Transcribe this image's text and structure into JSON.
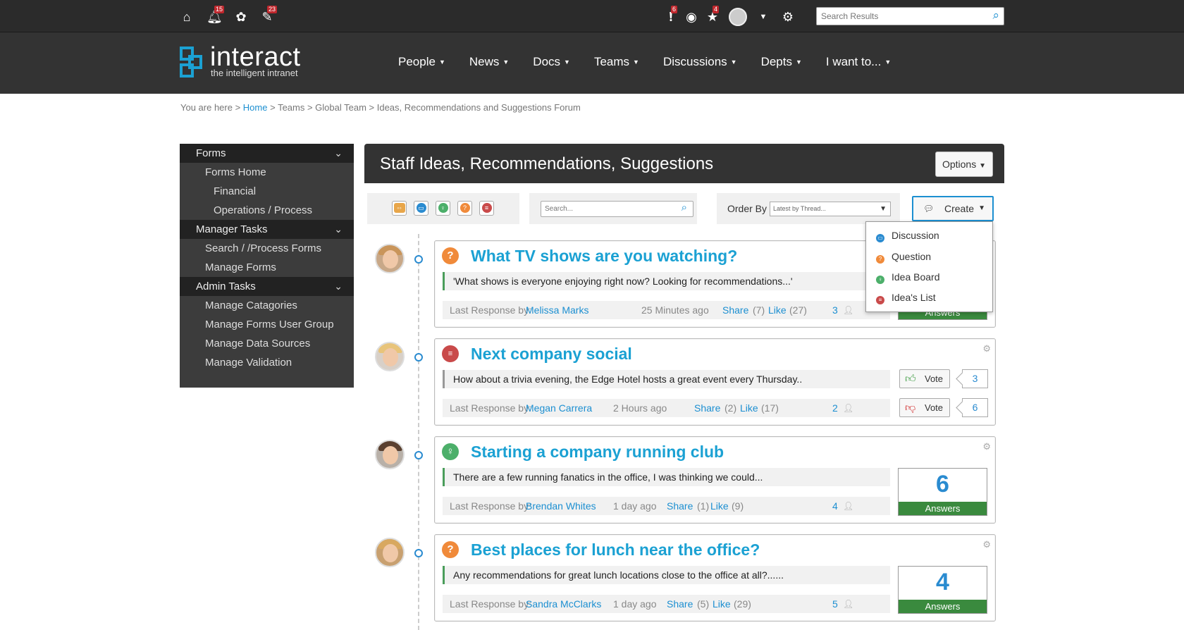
{
  "topbar": {
    "home_icon": "home-icon",
    "notifications_badge": "15",
    "flower_icon": "flower-icon",
    "docs_badge": "23",
    "alert_badge": "6",
    "star_badge": "4",
    "search_placeholder": "Search Results"
  },
  "logo": {
    "word": "interact",
    "tagline": "the intelligent intranet"
  },
  "nav": [
    {
      "label": "People"
    },
    {
      "label": "News"
    },
    {
      "label": "Docs"
    },
    {
      "label": "Teams"
    },
    {
      "label": "Discussions"
    },
    {
      "label": "Depts"
    },
    {
      "label": "I want to..."
    }
  ],
  "breadcrumb": {
    "prefix": "You are here > ",
    "home": "Home",
    "rest": " > Teams > Global Team > Ideas, Recommendations and Suggestions Forum"
  },
  "sidebar": {
    "forms": "Forms",
    "forms_home": "Forms Home",
    "financial": "Financial",
    "operations": "Operations / Process",
    "manager_tasks": "Manager Tasks",
    "search_forms": "Search / /Process Forms",
    "manage_forms": "Manage Forms",
    "admin_tasks": "Admin Tasks",
    "manage_categories": "Manage Catagories",
    "manage_user_group": "Manage Forms User Group",
    "manage_data_sources": "Manage Data Sources",
    "manage_validation": "Manage Validation"
  },
  "panel": {
    "title": "Staff Ideas, Recommendations, Suggestions",
    "options": "Options"
  },
  "toolbar": {
    "search_placeholder": "Search...",
    "order_label": "Order By",
    "order_value": "Latest by Thread...",
    "create_label": "Create"
  },
  "create_menu": [
    {
      "label": "Discussion",
      "color": "#2a8bd0"
    },
    {
      "label": "Question",
      "color": "#f08a3a"
    },
    {
      "label": "Idea Board",
      "color": "#4caf6a"
    },
    {
      "label": "Idea's List",
      "color": "#c94a4a"
    }
  ],
  "colors": {
    "accent": "#1ba1d3",
    "answers_green": "#3a8a3e",
    "question_orange": "#f08a3a",
    "idea_green": "#4caf6a",
    "idealist_red": "#c94a4a"
  },
  "posts": [
    {
      "title": "What TV shows are you watching?",
      "excerpt": "'What shows is everyone enjoying right now? Looking for recommendations...'",
      "last_label": "Last Response by: ",
      "author": "Melissa Marks",
      "time": "25 Minutes ago",
      "share": "Share",
      "share_count": "(7)",
      "like": "Like",
      "like_count": "(27)",
      "participants": "3",
      "answers": "",
      "answers_label": "Answers"
    },
    {
      "title": "Next company social",
      "excerpt": "How about a trivia evening, the Edge Hotel hosts a great event every Thursday..",
      "last_label": "Last Response by: ",
      "author": "Megan Carrera",
      "time": "2 Hours ago",
      "share": "Share",
      "share_count": "(2)",
      "like": "Like",
      "like_count": "(17)",
      "participants": "2",
      "vote_label": "Vote",
      "votes_up": "3",
      "votes_down": "6"
    },
    {
      "title": "Starting a company running club",
      "excerpt": "There are a few running fanatics in the office, I was thinking we could...",
      "last_label": "Last Response by: ",
      "author": "Brendan Whites",
      "time": "1 day ago",
      "share": "Share",
      "share_count": "(1)",
      "like": "Like",
      "like_count": "(9)",
      "participants": "4",
      "answers": "6",
      "answers_label": "Answers"
    },
    {
      "title": "Best places for lunch near the office?",
      "excerpt": "Any recommendations for great lunch locations close to the office at all?......",
      "last_label": "Last Response by: ",
      "author": "Sandra McClarks",
      "time": "1 day ago",
      "share": "Share",
      "share_count": "(5)",
      "like": "Like",
      "like_count": "(29)",
      "participants": "5",
      "answers": "4",
      "answers_label": "Answers"
    }
  ]
}
